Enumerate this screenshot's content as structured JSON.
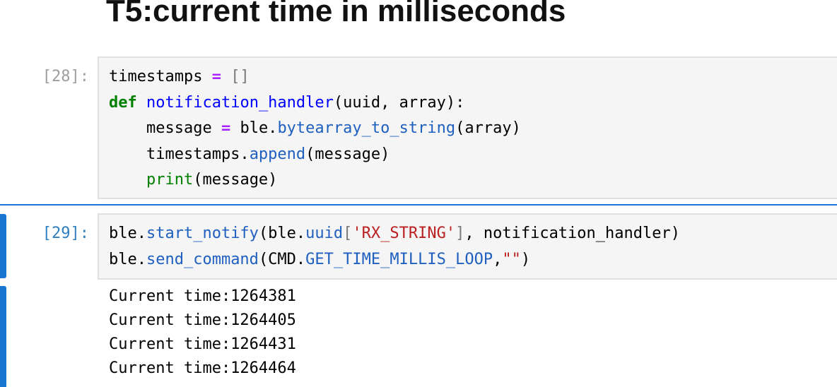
{
  "heading": "T5:current time in milliseconds",
  "cells": [
    {
      "prompt": "[28]:",
      "code_lines": [
        "timestamps = []",
        "def notification_handler(uuid, array):",
        "    message = ble.bytearray_to_string(array)",
        "    timestamps.append(message)",
        "    print(message)"
      ]
    },
    {
      "prompt": "[29]:",
      "code_lines": [
        "ble.start_notify(ble.uuid['RX_STRING'], notification_handler)",
        "ble.send_command(CMD.GET_TIME_MILLIS_LOOP,\"\")"
      ],
      "output_lines": [
        "Current time:1264381",
        "Current time:1264405",
        "Current time:1264431",
        "Current time:1264464"
      ]
    }
  ],
  "colors": {
    "selected_cell": "#1976d2",
    "prompt_active": "#307fc1",
    "prompt_inactive": "#9e9e9e",
    "keyword": "#008000",
    "function_name": "#0000ff",
    "operator": "#aa22ff",
    "attribute": "#1f5fbf",
    "string": "#ba2121",
    "input_background": "#f5f5f5"
  }
}
